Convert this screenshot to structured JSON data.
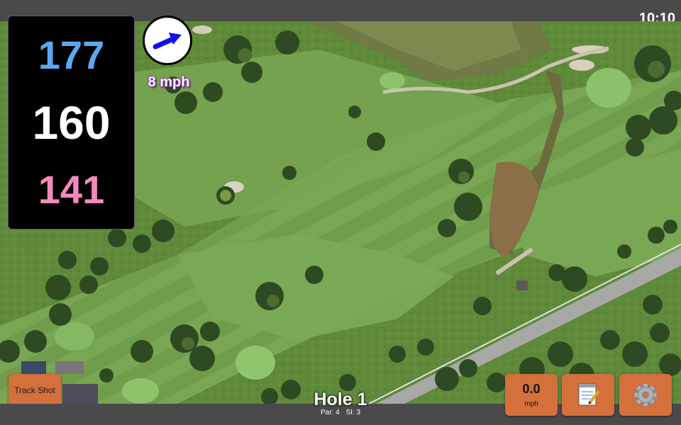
{
  "status": {
    "time": "10:10"
  },
  "distances": {
    "back": "177",
    "middle": "160",
    "front": "141"
  },
  "wind": {
    "speed_label": "8 mph",
    "direction_icon": "arrow-icon"
  },
  "hole": {
    "title": "Hole 1",
    "par": "Par: 4",
    "stroke_index": "SI: 3"
  },
  "buttons": {
    "track_shot": "Track Shot",
    "speed_value": "0.0",
    "speed_unit": "mph",
    "notes_icon": "notepad-icon",
    "settings_icon": "gear-icon"
  },
  "colors": {
    "back_distance": "#5ba8ef",
    "middle_distance": "#ffffff",
    "front_distance": "#f48ac0",
    "button": "#d4703c",
    "wind_text_outline": "#7a2b9a"
  }
}
